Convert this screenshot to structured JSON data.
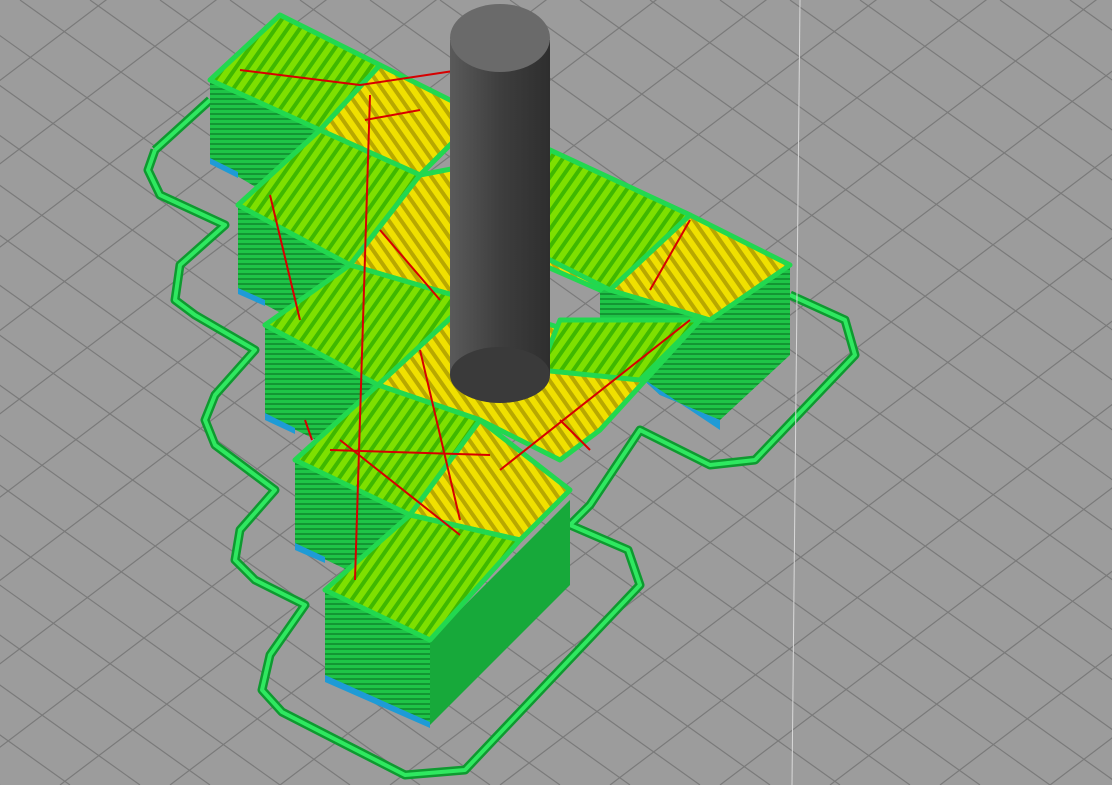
{
  "view": {
    "background": "#9c9c9c",
    "grid_color": "#7a7a7a",
    "colors": {
      "perimeter": "#1fd14e",
      "perimeter_dark": "#0e9a30",
      "wall_mid": "#18b83c",
      "infill_outer": "#7ee000",
      "infill_inner": "#f0e000",
      "travel": "#d60000",
      "first_layer": "#1e9bd6",
      "nozzle": "#4a4a4a",
      "nozzle_top": "#6a6a6a"
    },
    "icons": {
      "nozzle": "cylinder-nozzle-icon"
    }
  }
}
